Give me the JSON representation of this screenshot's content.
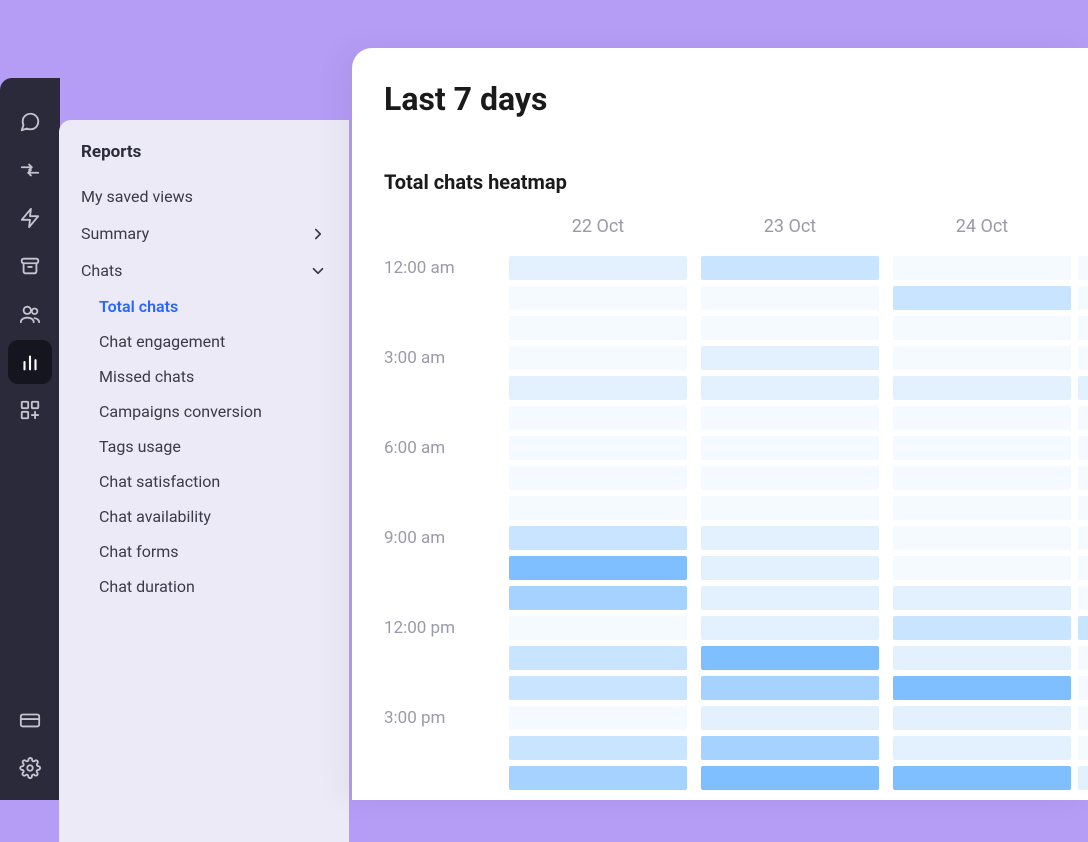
{
  "sidebar": {
    "title": "Reports",
    "items": [
      {
        "label": "My saved views",
        "type": "plain"
      },
      {
        "label": "Summary",
        "type": "chevron-right"
      },
      {
        "label": "Chats",
        "type": "chevron-down"
      }
    ],
    "sub_items": [
      {
        "label": "Total chats",
        "active": true
      },
      {
        "label": "Chat engagement"
      },
      {
        "label": "Missed chats"
      },
      {
        "label": "Campaigns conversion"
      },
      {
        "label": "Tags usage"
      },
      {
        "label": "Chat satisfaction"
      },
      {
        "label": "Chat availability"
      },
      {
        "label": "Chat forms"
      },
      {
        "label": "Chat duration"
      }
    ]
  },
  "rail_icons": [
    "chat-icon",
    "arrows-icon",
    "bolt-icon",
    "archive-icon",
    "team-icon",
    "reports-icon",
    "apps-icon"
  ],
  "rail_bottom_icons": [
    "billing-icon",
    "settings-icon"
  ],
  "content": {
    "title": "Last 7 days",
    "chart_title": "Total chats heatmap"
  },
  "chart_data": {
    "type": "heatmap",
    "title": "Total chats heatmap",
    "xlabel": "",
    "ylabel": "",
    "x_categories": [
      "22 Oct",
      "23 Oct",
      "24 Oct"
    ],
    "y_categories": [
      "12:00 am",
      "3:00 am",
      "6:00 am",
      "9:00 am",
      "12:00 pm",
      "3:00 pm"
    ],
    "y_step_hours": 1,
    "partial_col_visible": true,
    "hour_labels_every": 3,
    "intensity_scale": [
      0,
      5
    ],
    "series": [
      {
        "name": "22 Oct",
        "values": [
          1,
          0,
          0,
          0,
          1,
          0,
          0,
          0,
          0,
          2,
          4,
          3,
          0,
          2,
          2,
          0,
          2,
          3
        ]
      },
      {
        "name": "23 Oct",
        "values": [
          2,
          0,
          0,
          1,
          1,
          0,
          0,
          0,
          0,
          1,
          1,
          1,
          1,
          4,
          3,
          1,
          3,
          4
        ]
      },
      {
        "name": "24 Oct",
        "values": [
          0,
          2,
          0,
          0,
          1,
          0,
          0,
          0,
          0,
          0,
          0,
          1,
          2,
          1,
          4,
          1,
          1,
          4
        ]
      },
      {
        "name": "partial",
        "values": [
          0,
          0,
          0,
          0,
          1,
          0,
          0,
          0,
          0,
          0,
          0,
          0,
          2,
          0,
          0,
          0,
          0,
          1
        ]
      }
    ],
    "color_map": {
      "0": "#f4faff",
      "1": "#e3f1ff",
      "2": "#c9e4ff",
      "3": "#a5d2ff",
      "4": "#7fbfff",
      "5": "#5aaeff"
    }
  }
}
